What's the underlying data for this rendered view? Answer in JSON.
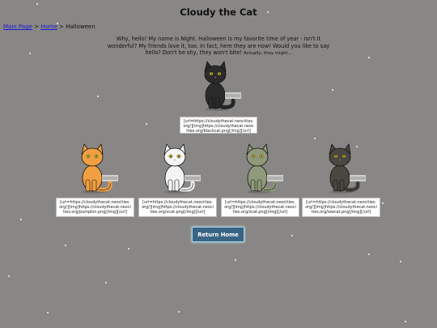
{
  "page": {
    "title": "Cloudy the Cat",
    "background": "#898785"
  },
  "breadcrumb": {
    "main_page": "Main Page",
    "sep1": ">",
    "home": "Home",
    "sep2": ">",
    "current": "Halloween"
  },
  "intro": {
    "text": "Why, hello! My name is Night. Halloween is my favorite time of year - isn't it wonderful? My friends love it, too. In fact, here they are now! Would you like to say hello? Don't be shy, they won't bite! ",
    "aside": "Actually, they might..."
  },
  "cats": [
    {
      "name": "blackcat",
      "fur": "#2b2b2b",
      "code": "[url=https://cloudythecat.neocities.org/][img]https://cloudythecat.neocities.org/blackcat.png[/img][/url]"
    },
    {
      "name": "pumpkin",
      "fur": "#f0a040",
      "code": "[url=https://cloudythecat.neocities.org/][img]https://cloudythecat.neocities.org/pumpkin.png[/img][/url]"
    },
    {
      "name": "vcat",
      "fur": "#f4f4f4",
      "code": "[url=https://cloudythecat.neocities.org/][img]https://cloudythecat.neocities.org/vcat.png[/img][/url]"
    },
    {
      "name": "zcat",
      "fur": "#8f9a7a",
      "code": "[url=https://cloudythecat.neocities.org/][img]https://cloudythecat.neocities.org/zcat.png[/img][/url]"
    },
    {
      "name": "wwcat",
      "fur": "#4a4640",
      "code": "[url=https://cloudythecat.neocities.org/][img]https://cloudythecat.neocities.org/wwcat.png[/img][/url]"
    }
  ],
  "return_button": {
    "label": "Return Home",
    "color": "#3a6484"
  }
}
